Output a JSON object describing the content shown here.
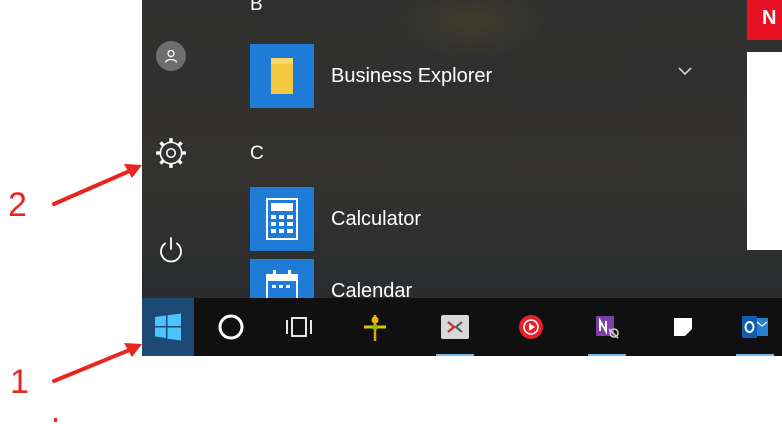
{
  "annotations": [
    "1",
    "2"
  ],
  "start_menu": {
    "sections": [
      {
        "letter": "B",
        "apps": [
          {
            "label": "Business Explorer",
            "icon": "folder-icon"
          }
        ]
      },
      {
        "letter": "C",
        "apps": [
          {
            "label": "Calculator",
            "icon": "calculator-icon"
          },
          {
            "label": "Calendar",
            "icon": "calendar-icon"
          }
        ]
      }
    ],
    "rail": [
      "user-avatar-icon",
      "settings-gear-icon",
      "power-icon"
    ],
    "live_tile_letter": "N"
  },
  "taskbar": {
    "items": [
      "windows-logo-icon",
      "cortana-circle-icon",
      "task-view-icon",
      "network-pin-icon",
      "remote-app-icon",
      "media-player-icon",
      "onenote-icon",
      "sticky-notes-icon",
      "outlook-icon"
    ]
  },
  "colors": {
    "accent": "#1e7bd6",
    "annotation": "#e8251f",
    "live_tile": "#e81123"
  }
}
